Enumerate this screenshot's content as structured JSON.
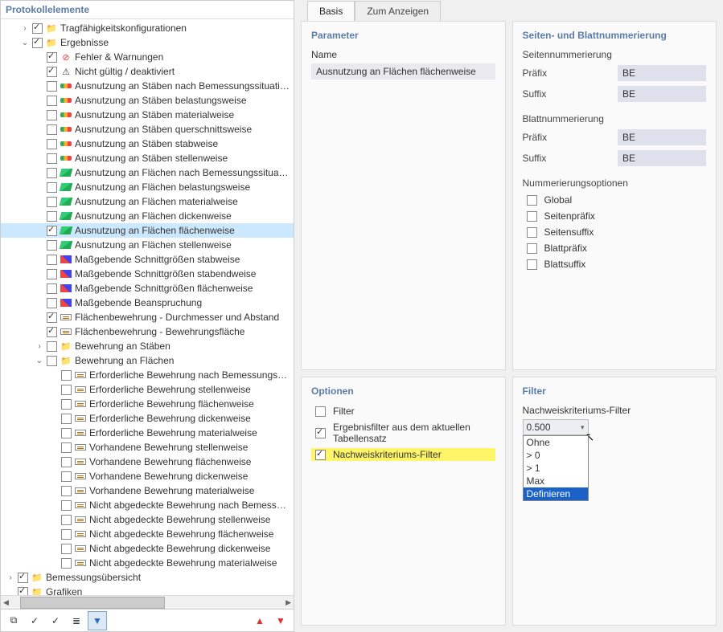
{
  "left_title": "Protokollelemente",
  "tree": [
    {
      "ind": 1,
      "exp": ">",
      "chk": true,
      "icn": "folder",
      "lbl": "Tragfähigkeitskonfigurationen"
    },
    {
      "ind": 1,
      "exp": "v",
      "chk": true,
      "icn": "folder",
      "lbl": "Ergebnisse"
    },
    {
      "ind": 2,
      "exp": "",
      "chk": true,
      "icn": "err",
      "lbl": "Fehler & Warnungen"
    },
    {
      "ind": 2,
      "exp": "",
      "chk": true,
      "icn": "warn",
      "lbl": "Nicht gültig / deaktiviert"
    },
    {
      "ind": 2,
      "exp": "",
      "chk": false,
      "icn": "util",
      "lbl": "Ausnutzung an Stäben nach Bemessungssituationsweise"
    },
    {
      "ind": 2,
      "exp": "",
      "chk": false,
      "icn": "util",
      "lbl": "Ausnutzung an Stäben belastungsweise"
    },
    {
      "ind": 2,
      "exp": "",
      "chk": false,
      "icn": "util",
      "lbl": "Ausnutzung an Stäben materialweise"
    },
    {
      "ind": 2,
      "exp": "",
      "chk": false,
      "icn": "util",
      "lbl": "Ausnutzung an Stäben querschnittsweise"
    },
    {
      "ind": 2,
      "exp": "",
      "chk": false,
      "icn": "util",
      "lbl": "Ausnutzung an Stäben stabweise"
    },
    {
      "ind": 2,
      "exp": "",
      "chk": false,
      "icn": "util",
      "lbl": "Ausnutzung an Stäben stellenweise"
    },
    {
      "ind": 2,
      "exp": "",
      "chk": false,
      "icn": "surf",
      "lbl": "Ausnutzung an Flächen nach Bemessungssituationsweise"
    },
    {
      "ind": 2,
      "exp": "",
      "chk": false,
      "icn": "surf",
      "lbl": "Ausnutzung an Flächen belastungsweise"
    },
    {
      "ind": 2,
      "exp": "",
      "chk": false,
      "icn": "surf",
      "lbl": "Ausnutzung an Flächen materialweise"
    },
    {
      "ind": 2,
      "exp": "",
      "chk": false,
      "icn": "surf",
      "lbl": "Ausnutzung an Flächen dickenweise"
    },
    {
      "ind": 2,
      "exp": "",
      "chk": true,
      "icn": "surf",
      "lbl": "Ausnutzung an Flächen flächenweise",
      "sel": true
    },
    {
      "ind": 2,
      "exp": "",
      "chk": false,
      "icn": "surf",
      "lbl": "Ausnutzung an Flächen stellenweise"
    },
    {
      "ind": 2,
      "exp": "",
      "chk": false,
      "icn": "cut",
      "lbl": "Maßgebende Schnittgrößen stabweise"
    },
    {
      "ind": 2,
      "exp": "",
      "chk": false,
      "icn": "cut",
      "lbl": "Maßgebende Schnittgrößen stabendweise"
    },
    {
      "ind": 2,
      "exp": "",
      "chk": false,
      "icn": "cut",
      "lbl": "Maßgebende Schnittgrößen flächenweise"
    },
    {
      "ind": 2,
      "exp": "",
      "chk": false,
      "icn": "cut",
      "lbl": "Maßgebende Beanspruchung"
    },
    {
      "ind": 2,
      "exp": "",
      "chk": true,
      "icn": "rebar",
      "lbl": "Flächenbewehrung - Durchmesser und Abstand"
    },
    {
      "ind": 2,
      "exp": "",
      "chk": true,
      "icn": "rebar",
      "lbl": "Flächenbewehrung - Bewehrungsfläche"
    },
    {
      "ind": 2,
      "exp": ">",
      "chk": false,
      "icn": "folder",
      "lbl": "Bewehrung an Stäben"
    },
    {
      "ind": 2,
      "exp": "v",
      "chk": false,
      "icn": "folder",
      "lbl": "Bewehrung an Flächen"
    },
    {
      "ind": 3,
      "exp": "",
      "chk": false,
      "icn": "rebar",
      "lbl": "Erforderliche Bewehrung nach Bemessungssituationsweise"
    },
    {
      "ind": 3,
      "exp": "",
      "chk": false,
      "icn": "rebar",
      "lbl": "Erforderliche Bewehrung stellenweise"
    },
    {
      "ind": 3,
      "exp": "",
      "chk": false,
      "icn": "rebar",
      "lbl": "Erforderliche Bewehrung flächenweise"
    },
    {
      "ind": 3,
      "exp": "",
      "chk": false,
      "icn": "rebar",
      "lbl": "Erforderliche Bewehrung dickenweise"
    },
    {
      "ind": 3,
      "exp": "",
      "chk": false,
      "icn": "rebar",
      "lbl": "Erforderliche Bewehrung materialweise"
    },
    {
      "ind": 3,
      "exp": "",
      "chk": false,
      "icn": "rebar",
      "lbl": "Vorhandene Bewehrung stellenweise"
    },
    {
      "ind": 3,
      "exp": "",
      "chk": false,
      "icn": "rebar",
      "lbl": "Vorhandene Bewehrung flächenweise"
    },
    {
      "ind": 3,
      "exp": "",
      "chk": false,
      "icn": "rebar",
      "lbl": "Vorhandene Bewehrung dickenweise"
    },
    {
      "ind": 3,
      "exp": "",
      "chk": false,
      "icn": "rebar",
      "lbl": "Vorhandene Bewehrung materialweise"
    },
    {
      "ind": 3,
      "exp": "",
      "chk": false,
      "icn": "rebar",
      "lbl": "Nicht abgedeckte Bewehrung nach Bemessungssituationsweise"
    },
    {
      "ind": 3,
      "exp": "",
      "chk": false,
      "icn": "rebar",
      "lbl": "Nicht abgedeckte Bewehrung stellenweise"
    },
    {
      "ind": 3,
      "exp": "",
      "chk": false,
      "icn": "rebar",
      "lbl": "Nicht abgedeckte Bewehrung flächenweise"
    },
    {
      "ind": 3,
      "exp": "",
      "chk": false,
      "icn": "rebar",
      "lbl": "Nicht abgedeckte Bewehrung dickenweise"
    },
    {
      "ind": 3,
      "exp": "",
      "chk": false,
      "icn": "rebar",
      "lbl": "Nicht abgedeckte Bewehrung materialweise"
    },
    {
      "ind": 0,
      "exp": ">",
      "chk": true,
      "icn": "folder",
      "lbl": "Bemessungsübersicht"
    },
    {
      "ind": 0,
      "exp": "",
      "chk": true,
      "icn": "folder",
      "lbl": "Grafiken"
    }
  ],
  "toolbar": {
    "t1": "⧉",
    "t2": "✓",
    "t3": "✓",
    "t4": "≣",
    "t5": "▼",
    "up": "▲",
    "down": "▼"
  },
  "tabs": {
    "basis": "Basis",
    "anzeigen": "Zum Anzeigen"
  },
  "parameter": {
    "title": "Parameter",
    "name_label": "Name",
    "name_value": "Ausnutzung an Flächen flächenweise"
  },
  "numbering": {
    "title": "Seiten- und Blattnummerierung",
    "page_sub": "Seitennummerierung",
    "sheet_sub": "Blattnummerierung",
    "opts_sub": "Nummerierungsoptionen",
    "prefix": "Präfix",
    "suffix": "Suffix",
    "be": "BE",
    "opts": [
      "Global",
      "Seitenpräfix",
      "Seitensuffix",
      "Blattpräfix",
      "Blattsuffix"
    ]
  },
  "optionen": {
    "title": "Optionen",
    "o1": "Filter",
    "o2": "Ergebnisfilter aus dem aktuellen Tabellensatz",
    "o3": "Nachweiskriteriums-Filter"
  },
  "filter": {
    "title": "Filter",
    "label": "Nachweiskriteriums-Filter",
    "selected": "0.500",
    "items": [
      "Ohne",
      "> 0",
      "> 1",
      "Max",
      "Definieren"
    ]
  }
}
